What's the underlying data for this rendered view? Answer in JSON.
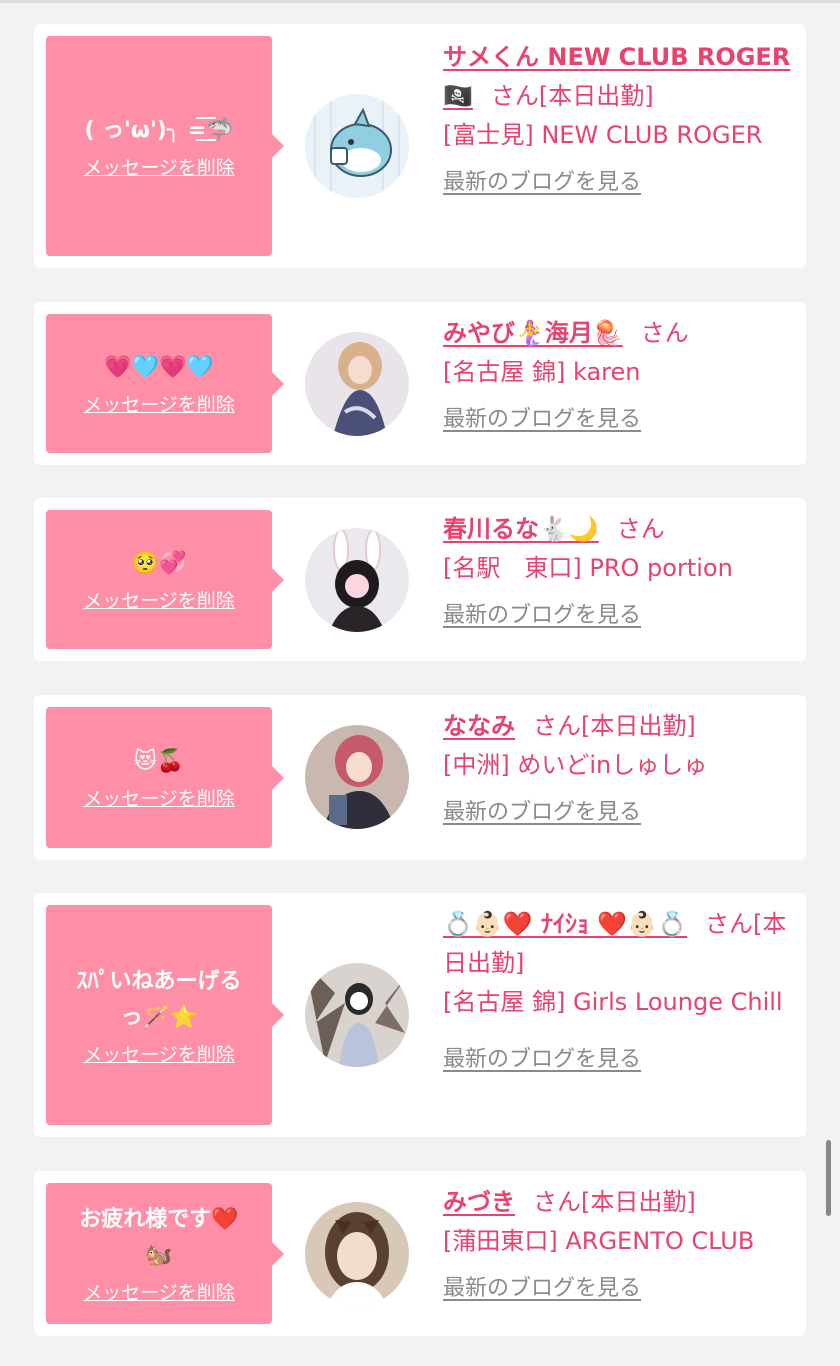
{
  "colors": {
    "accent": "#e8426e",
    "bubble": "#ff8fa7",
    "link_gray": "#8a8a8a"
  },
  "delete_label": "メッセージを削除",
  "san_label": "さん",
  "blog_label": "最新のブログを見る",
  "items": [
    {
      "message_lines": [
        "( っ'ω')╮ =͟͟͞͞🦈"
      ],
      "name": "サメくん NEW CLUB ROGER🏴‍☠️",
      "status": "[本日出勤]",
      "shop": "[富士見] NEW CLUB ROGER"
    },
    {
      "message_lines": [
        "💗🩵💗🩵"
      ],
      "name": "みやび🧜‍♀️海月🪼",
      "status": "",
      "shop": "[名古屋 錦] karen"
    },
    {
      "message_lines": [
        "🥺💞"
      ],
      "name": "春川るな🐇🌙",
      "status": "",
      "shop": "[名駅　東口] PRO portion"
    },
    {
      "message_lines": [
        "😻🍒"
      ],
      "name": "ななみ",
      "status": "[本日出勤]",
      "shop": "[中洲] めいどinしゅしゅ"
    },
    {
      "message_lines": [
        "ｽﾊﾟいねあーげる",
        "っ🪄⭐️"
      ],
      "name": "💍👶🏻❤️ ﾅｲｼｮ ❤️👶🏻💍",
      "status": "[本日出勤]",
      "shop": "[名古屋 錦] Girls Lounge Chill"
    },
    {
      "message_lines": [
        "お疲れ様です❤️",
        "🐿️"
      ],
      "name": "みづき",
      "status": "[本日出勤]",
      "shop": "[蒲田東口] ARGENTO CLUB"
    }
  ]
}
